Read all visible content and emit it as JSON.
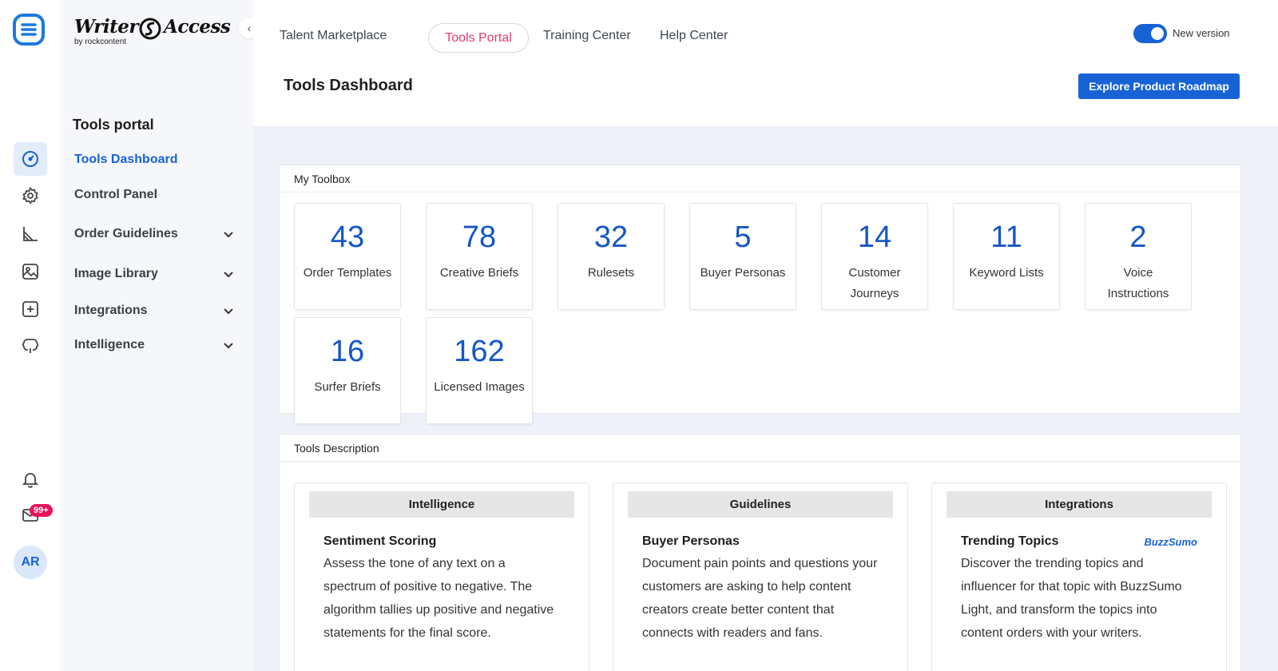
{
  "brand": {
    "word1": "Writer",
    "word2": "Access",
    "byline": "by rockcontent"
  },
  "rail": {
    "notification_badge": "99+",
    "avatar_initials": "AR"
  },
  "sidebar": {
    "title": "Tools portal",
    "items": [
      {
        "label": "Tools Dashboard",
        "active": true,
        "expandable": false
      },
      {
        "label": "Control Panel",
        "active": false,
        "expandable": false
      },
      {
        "label": "Order Guidelines",
        "active": false,
        "expandable": true
      },
      {
        "label": "Image Library",
        "active": false,
        "expandable": true
      },
      {
        "label": "Integrations",
        "active": false,
        "expandable": true
      },
      {
        "label": "Intelligence",
        "active": false,
        "expandable": true
      }
    ]
  },
  "topnav": {
    "links": [
      "Talent Marketplace",
      "Tools Portal",
      "Training Center",
      "Help Center"
    ],
    "active": "Tools Portal",
    "toggle_label": "New version",
    "toggle_on": true
  },
  "header": {
    "title": "Tools Dashboard",
    "roadmap_button": "Explore Product Roadmap"
  },
  "toolbox": {
    "title": "My Toolbox",
    "tiles": [
      {
        "count": "43",
        "label": "Order Templates"
      },
      {
        "count": "78",
        "label": "Creative Briefs"
      },
      {
        "count": "32",
        "label": "Rulesets"
      },
      {
        "count": "5",
        "label": "Buyer Personas"
      },
      {
        "count": "14",
        "label": "Customer Journeys"
      },
      {
        "count": "11",
        "label": "Keyword Lists"
      },
      {
        "count": "2",
        "label": "Voice Instructions"
      },
      {
        "count": "16",
        "label": "Surfer Briefs"
      },
      {
        "count": "162",
        "label": "Licensed Images"
      }
    ]
  },
  "descriptions": {
    "title": "Tools Description",
    "columns": [
      {
        "category": "Intelligence",
        "tool": "Sentiment Scoring",
        "text": "Assess the tone of any text on a spectrum of positive to negative. The algorithm tallies up positive and negative statements for the final score."
      },
      {
        "category": "Guidelines",
        "tool": "Buyer Personas",
        "text": "Document pain points and questions your customers are asking to help content creators create better content that connects with readers and fans."
      },
      {
        "category": "Integrations",
        "tool": "Trending Topics",
        "partner_logo": "BuzzSumo",
        "text": "Discover the trending topics and influencer for that topic with BuzzSumo Light, and transform the topics into content orders with your writers."
      }
    ]
  },
  "colors": {
    "accent": "#1763d6",
    "pill_text": "#e23b6b",
    "badge": "#e8125c",
    "main_bg": "#eef2f8"
  }
}
